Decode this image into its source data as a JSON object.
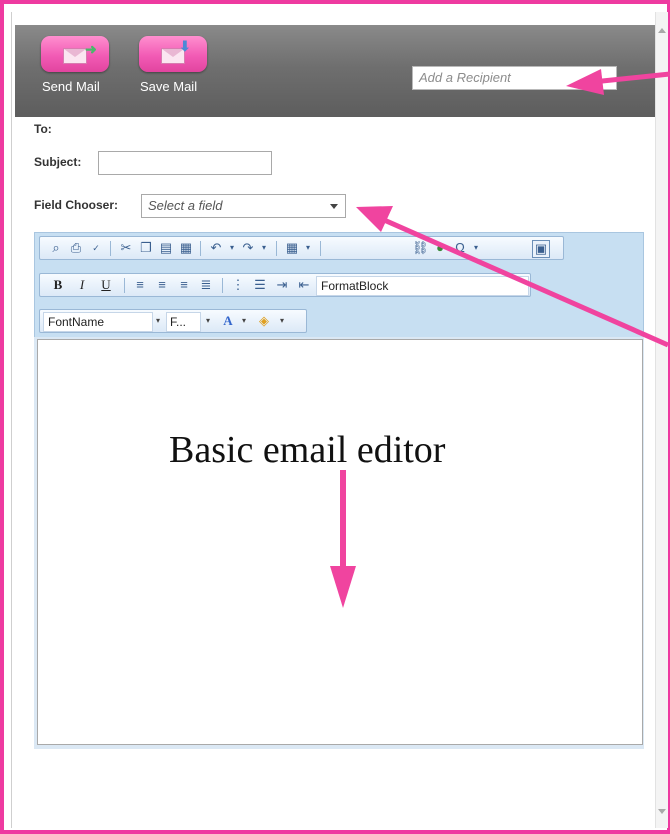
{
  "toolbar": {
    "send_label": "Send Mail",
    "save_label": "Save Mail",
    "recipient_placeholder": "Add a Recipient"
  },
  "form": {
    "to_label": "To:",
    "subject_label": "Subject:",
    "subject_value": "",
    "field_chooser_label": "Field Chooser:",
    "field_chooser_placeholder": "Select a field"
  },
  "editor_toolbar": {
    "format_block": "FormatBlock",
    "font_name": "FontName",
    "font_size": "F..."
  },
  "annotation": {
    "caption": "Basic email editor"
  },
  "colors": {
    "frame": "#ee3aa0",
    "annotation_arrow": "#f0449f",
    "header_band": "#6f6f6f",
    "button_pink": "#f25bb5"
  }
}
